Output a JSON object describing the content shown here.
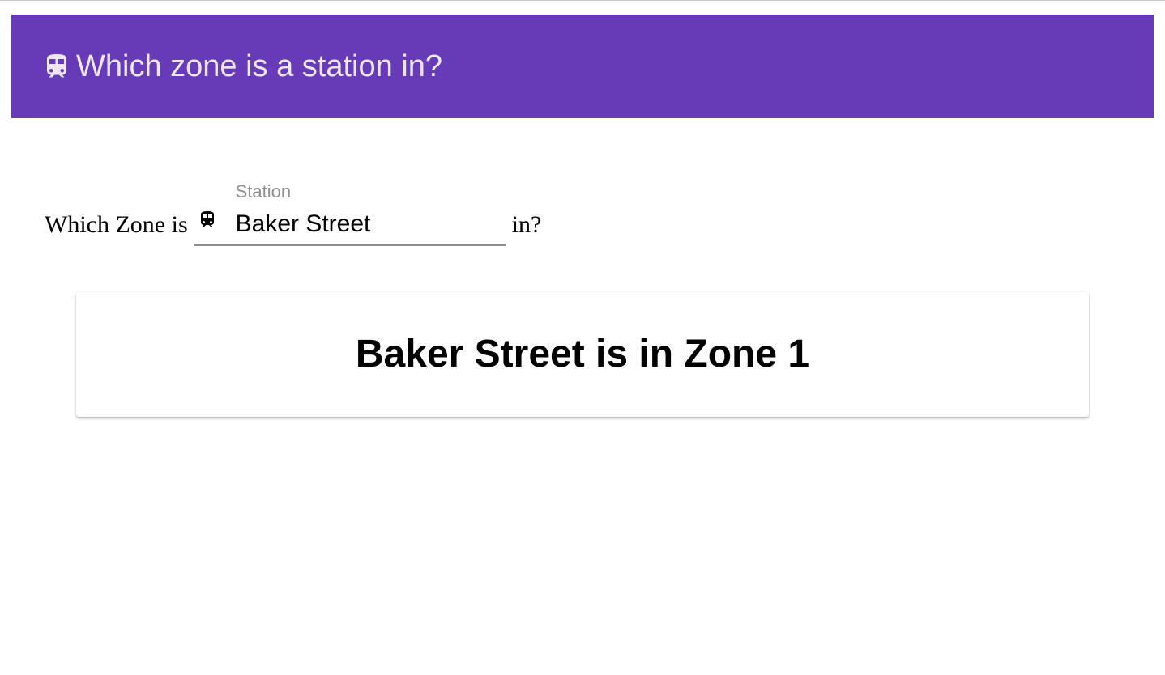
{
  "toolbar": {
    "icon": "train-icon",
    "title": "Which zone is a station in?",
    "background": "#673ab7"
  },
  "question": {
    "prefix": "Which Zone is",
    "suffix": "in?"
  },
  "station_field": {
    "label": "Station",
    "icon": "train-icon",
    "value": "Baker Street"
  },
  "result": {
    "text": "Baker Street is in Zone 1"
  }
}
